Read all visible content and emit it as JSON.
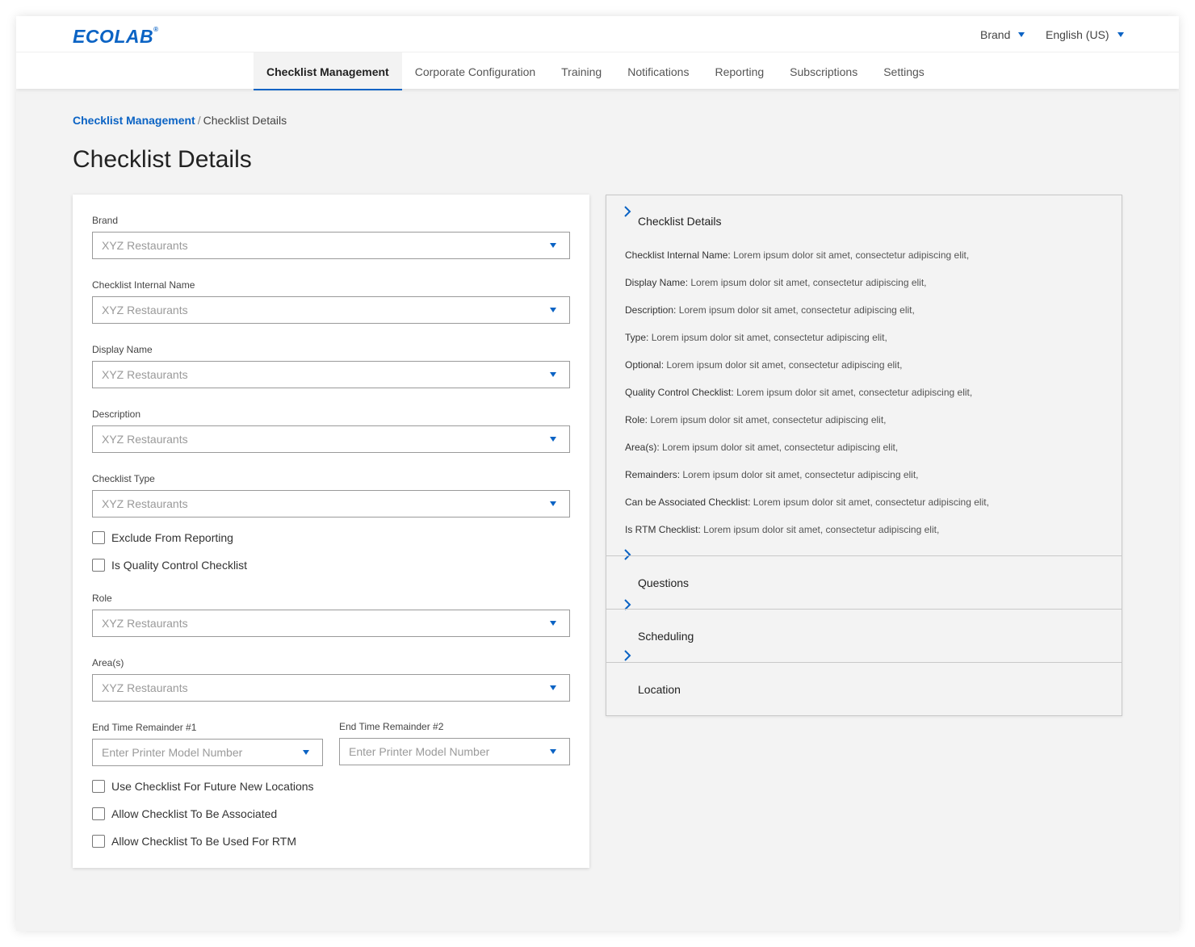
{
  "header": {
    "logo": "ECOLAB",
    "logo_mark": "®",
    "brand_label": "Brand",
    "language_label": "English (US)"
  },
  "nav": {
    "tabs": [
      {
        "label": "Checklist Management",
        "active": true
      },
      {
        "label": "Corporate Configuration",
        "active": false
      },
      {
        "label": "Training",
        "active": false
      },
      {
        "label": "Notifications",
        "active": false
      },
      {
        "label": "Reporting",
        "active": false
      },
      {
        "label": "Subscriptions",
        "active": false
      },
      {
        "label": "Settings",
        "active": false
      }
    ]
  },
  "breadcrumb": {
    "parent": "Checklist Management",
    "separator": "/",
    "current": "Checklist Details"
  },
  "page_title": "Checklist Details",
  "form": {
    "brand": {
      "label": "Brand",
      "value": "XYZ Restaurants"
    },
    "internal_name": {
      "label": "Checklist Internal Name",
      "value": "XYZ Restaurants"
    },
    "display_name": {
      "label": "Display Name",
      "value": "XYZ Restaurants"
    },
    "description": {
      "label": "Description",
      "value": "XYZ Restaurants"
    },
    "checklist_type": {
      "label": "Checklist Type",
      "value": "XYZ Restaurants"
    },
    "exclude_reporting": {
      "label": "Exclude From Reporting",
      "checked": false
    },
    "quality_control": {
      "label": "Is Quality Control Checklist",
      "checked": false
    },
    "role": {
      "label": "Role",
      "value": "XYZ Restaurants"
    },
    "areas": {
      "label": "Area(s)",
      "value": "XYZ Restaurants"
    },
    "end_time_1": {
      "label": "End Time Remainder #1",
      "placeholder": "Enter Printer Model Number"
    },
    "end_time_2": {
      "label": "End Time Remainder #2",
      "placeholder": "Enter Printer Model Number"
    },
    "future_locations": {
      "label": "Use Checklist For Future New Locations",
      "checked": false
    },
    "allow_associated": {
      "label": "Allow Checklist To Be Associated",
      "checked": false
    },
    "allow_rtm": {
      "label": "Allow Checklist To Be Used For RTM",
      "checked": false
    }
  },
  "summary": {
    "details_heading": "Checklist Details",
    "rows": [
      {
        "key": "Checklist Internal Name:",
        "value": "Lorem ipsum dolor sit amet, consectetur adipiscing elit,"
      },
      {
        "key": "Display Name:",
        "value": "Lorem ipsum dolor sit amet, consectetur adipiscing elit,"
      },
      {
        "key": "Description:",
        "value": "Lorem ipsum dolor sit amet, consectetur adipiscing elit,"
      },
      {
        "key": "Type:",
        "value": "Lorem ipsum dolor sit amet, consectetur adipiscing elit,"
      },
      {
        "key": "Optional:",
        "value": "Lorem ipsum dolor sit amet, consectetur adipiscing elit,"
      },
      {
        "key": "Quality Control Checklist:",
        "value": "Lorem ipsum dolor sit amet, consectetur adipiscing elit,"
      },
      {
        "key": "Role:",
        "value": "Lorem ipsum dolor sit amet, consectetur adipiscing elit,"
      },
      {
        "key": "Area(s):",
        "value": "Lorem ipsum dolor sit amet, consectetur adipiscing elit,"
      },
      {
        "key": "Remainders:",
        "value": "Lorem ipsum dolor sit amet, consectetur adipiscing elit,"
      },
      {
        "key": "Can be Associated Checklist:",
        "value": "Lorem ipsum dolor sit amet, consectetur adipiscing elit,"
      },
      {
        "key": "Is RTM Checklist:",
        "value": "Lorem ipsum dolor sit amet, consectetur adipiscing elit,"
      }
    ],
    "sections": [
      "Questions",
      "Scheduling",
      "Location"
    ]
  },
  "colors": {
    "accent": "#0b63c4",
    "background": "#f3f3f3"
  }
}
